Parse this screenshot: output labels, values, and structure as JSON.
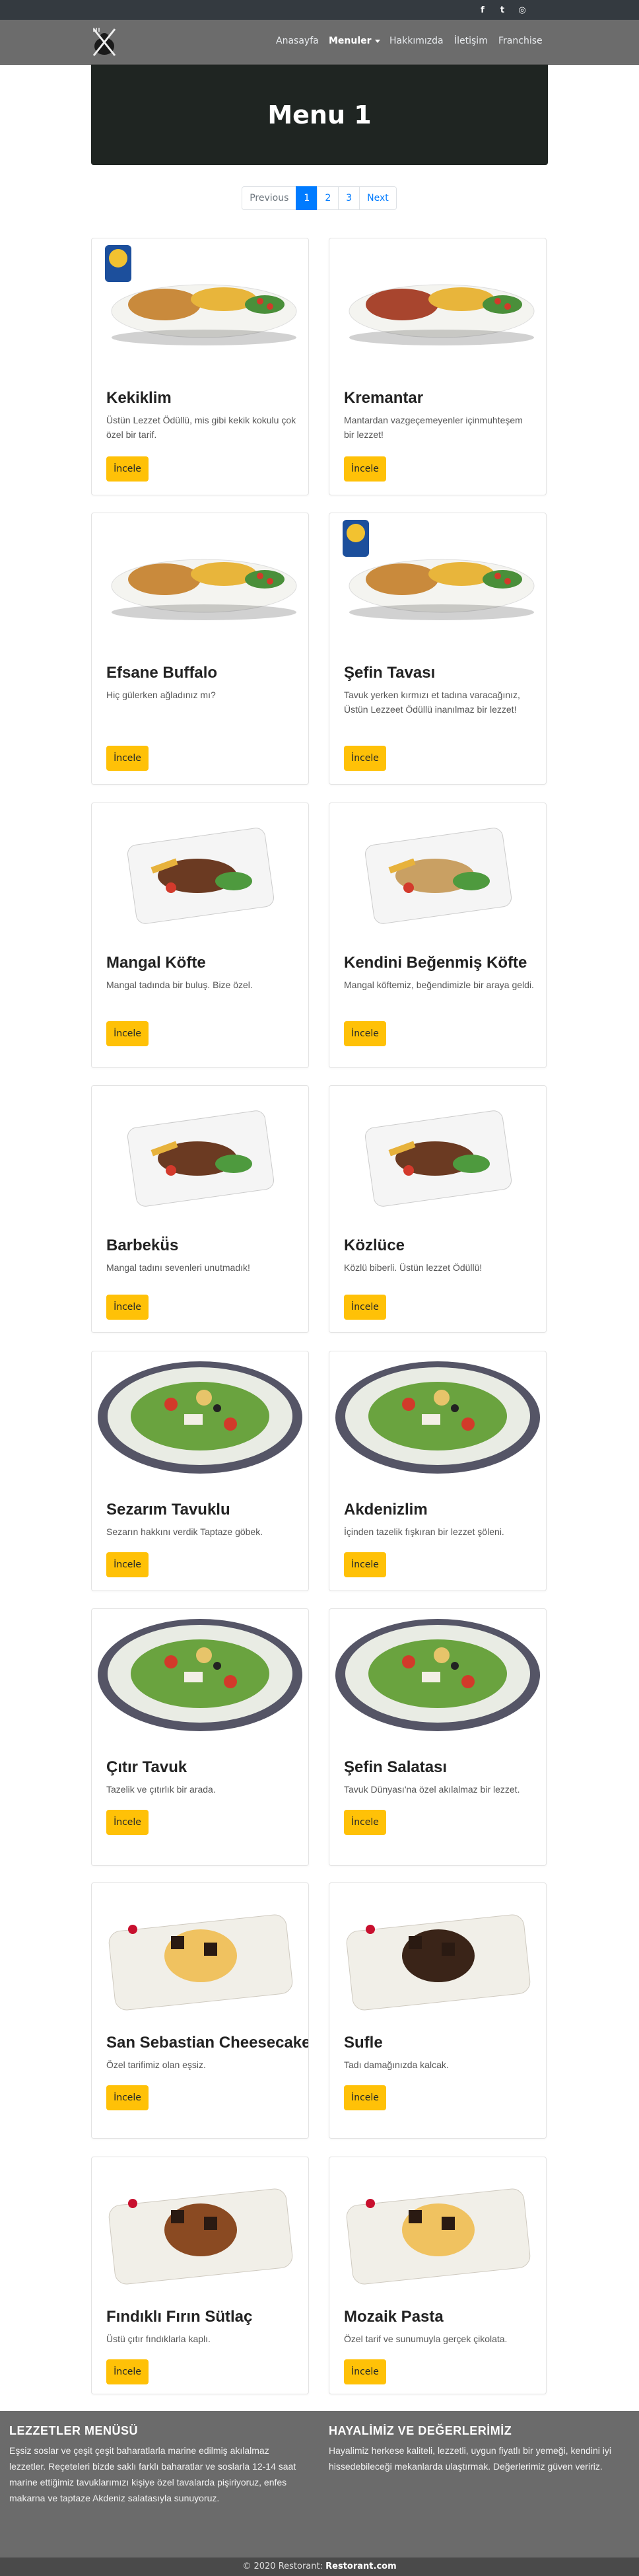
{
  "topbar": {
    "social": [
      {
        "name": "facebook-icon",
        "glyph": "f"
      },
      {
        "name": "twitter-icon",
        "glyph": "t"
      },
      {
        "name": "instagram-icon",
        "glyph": "◎"
      }
    ]
  },
  "nav": {
    "items": [
      {
        "label": "Anasayfa"
      },
      {
        "label": "Menuler"
      },
      {
        "label": "Hakkımızda"
      },
      {
        "label": "İletişim"
      },
      {
        "label": "Franchise"
      }
    ]
  },
  "hero": {
    "title": "Menu 1"
  },
  "pagination": {
    "previous": "Previous",
    "pages": [
      "1",
      "2",
      "3"
    ],
    "next": "Next",
    "current": "1"
  },
  "menu": {
    "button_label": "İncele",
    "items": [
      {
        "title": "Kekiklim",
        "text": "Üstün Lezzet Ödüllü, mis gibi kekik kokulu çok özel bir tarif.",
        "image": "platter-icon"
      },
      {
        "title": "Kremantar",
        "text": "Mantardan vazgeçemeyenler içinmuhteşem bir lezzet!",
        "image": "platter-icon"
      },
      {
        "title": "Efsane Buffalo",
        "text": "Hiç gülerken ağladınız mı?",
        "image": "platter-icon"
      },
      {
        "title": "Şefin Tavası",
        "text": "Tavuk yerken kırmızı et tadına varacağınız, Üstün Lezzeet Ödüllü inanılmaz bir lezzet!",
        "image": "platter-icon"
      },
      {
        "title": "Mangal Köfte",
        "text": "Mangal tadında bir buluş. Bize özel.",
        "image": "plate-icon"
      },
      {
        "title": "Kendini Beğenmiş Köfte",
        "text": "Mangal köftemiz, beğendimizle bir araya geldi.",
        "image": "plate-icon"
      },
      {
        "title": "Barbekü̈s",
        "text": "Mangal tadını sevenleri unutmadık!",
        "image": "plate-icon"
      },
      {
        "title": "Közlüce",
        "text": "Közlü biberli. Üstün lezzet Ödüllü!",
        "image": "plate-icon"
      },
      {
        "title": "Sezarım Tavuklu",
        "text": "Sezarın hakkını verdik Taptaze göbek.",
        "image": "salad-icon"
      },
      {
        "title": "Akdenizlim",
        "text": "İçinden tazelik fışkıran bir lezzet şöleni.",
        "image": "salad-icon"
      },
      {
        "title": "Çıtır Tavuk",
        "text": "Tazelik ve çıtırlık bir arada.",
        "image": "salad-icon"
      },
      {
        "title": "Şefin Salatası",
        "text": "Tavuk Dünyası'na özel akılalmaz bir lezzet.",
        "image": "salad-icon"
      },
      {
        "title": "San Sebastian Cheesecake",
        "text": "Özel tarifimiz olan eşsiz.",
        "image": "dessert-icon"
      },
      {
        "title": "Sufle",
        "text": "Tadı damağınızda kalcak.",
        "image": "dessert-icon"
      },
      {
        "title": "Fındıklı Fırın Sütlaç",
        "text": "Üstü çıtır fındıklarla kaplı.",
        "image": "dessert-icon"
      },
      {
        "title": "Mozaik Pasta",
        "text": "Özel tarif ve sunumuyla gerçek çikolata.",
        "image": "dessert-icon"
      }
    ]
  },
  "footer": {
    "left_title": "LEZZETLER MENÜSÜ",
    "left_text": "Eşsiz soslar ve çeşit çeşit baharatlarla marine edilmiş akılalmaz lezzetler. Reçeteleri bizde saklı farklı baharatlar ve soslarla 12-14 saat marine ettiğimiz tavuklarımızı kişiye özel tavalarda pişiriyoruz, enfes makarna ve taptaze Akdeniz salatasıyla sunuyoruz.",
    "right_title": "HAYALİMİZ VE DEĞERLERİMİZ",
    "right_text": "Hayalimiz herkese kaliteli, lezzetli, uygun fiyatlı bir yemeği, kendini iyi hissedebileceği mekanlarda ulaştırmak. Değerlerimiz güven veririz.",
    "copyright": "© 2020 Restorant:",
    "brand": "Restorant.com"
  },
  "colors": {
    "button": "#ffc107",
    "active_page": "#007bff",
    "navbar": "#6c6c6c",
    "hero": "#1f2522",
    "footer": "#6b6b6b"
  }
}
